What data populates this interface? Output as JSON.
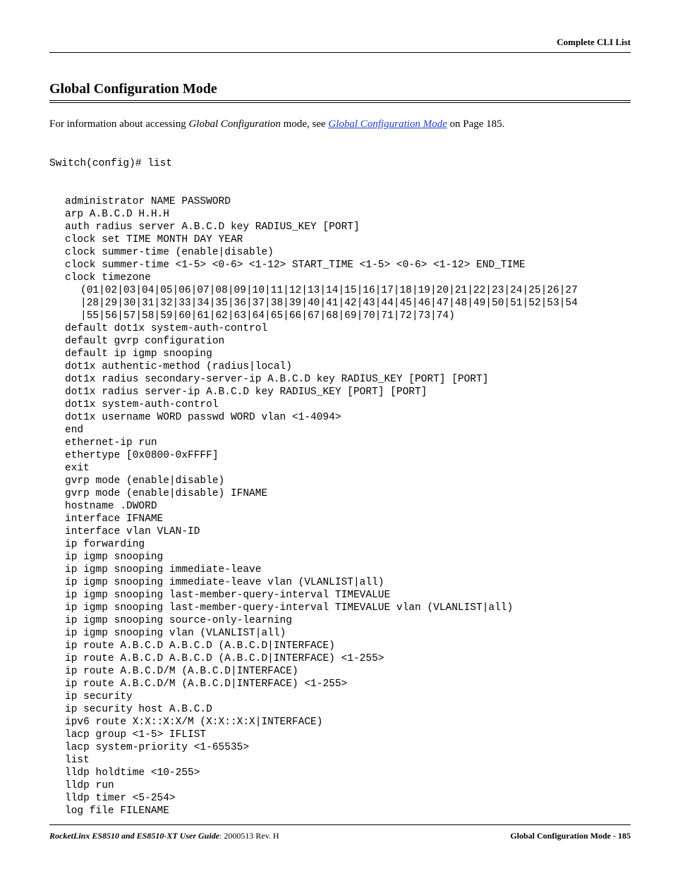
{
  "header": {
    "right_label": "Complete CLI List"
  },
  "section": {
    "title": "Global Configuration Mode"
  },
  "intro": {
    "prefix": "For information about accessing ",
    "emph": "Global Configuration",
    "mid": " mode, see ",
    "link_text": "Global Configuration Mode",
    "suffix": " on Page 185."
  },
  "cli": {
    "prompt": "Switch(config)# list",
    "lines": [
      "administrator NAME PASSWORD",
      "arp A.B.C.D H.H.H",
      "auth radius server A.B.C.D key RADIUS_KEY [PORT]",
      "clock set TIME MONTH DAY YEAR",
      "clock summer-time (enable|disable)",
      "clock summer-time <1-5> <0-6> <1-12> START_TIME <1-5> <0-6> <1-12> END_TIME",
      "clock timezone ",
      "(01|02|03|04|05|06|07|08|09|10|11|12|13|14|15|16|17|18|19|20|21|22|23|24|25|26|27",
      "|28|29|30|31|32|33|34|35|36|37|38|39|40|41|42|43|44|45|46|47|48|49|50|51|52|53|54",
      "|55|56|57|58|59|60|61|62|63|64|65|66|67|68|69|70|71|72|73|74)",
      "default dot1x system-auth-control",
      "default gvrp configuration",
      "default ip igmp snooping",
      "dot1x authentic-method (radius|local)",
      "dot1x radius secondary-server-ip A.B.C.D key RADIUS_KEY [PORT] [PORT]",
      "dot1x radius server-ip A.B.C.D key RADIUS_KEY [PORT] [PORT]",
      "dot1x system-auth-control",
      "dot1x username WORD passwd WORD vlan <1-4094>",
      "end",
      "ethernet-ip run",
      "ethertype [0x0800-0xFFFF]",
      "exit",
      "gvrp mode (enable|disable)",
      "gvrp mode (enable|disable) IFNAME",
      "hostname .DWORD",
      "interface IFNAME",
      "interface vlan VLAN-ID",
      "ip forwarding",
      "ip igmp snooping",
      "ip igmp snooping immediate-leave",
      "ip igmp snooping immediate-leave vlan (VLANLIST|all)",
      "ip igmp snooping last-member-query-interval TIMEVALUE",
      "ip igmp snooping last-member-query-interval TIMEVALUE vlan (VLANLIST|all)",
      "ip igmp snooping source-only-learning",
      "ip igmp snooping vlan (VLANLIST|all)",
      "ip route A.B.C.D A.B.C.D (A.B.C.D|INTERFACE)",
      "ip route A.B.C.D A.B.C.D (A.B.C.D|INTERFACE) <1-255>",
      "ip route A.B.C.D/M (A.B.C.D|INTERFACE)",
      "ip route A.B.C.D/M (A.B.C.D|INTERFACE) <1-255>",
      "ip security",
      "ip security host A.B.C.D",
      "ipv6 route X:X::X:X/M (X:X::X:X|INTERFACE)",
      "lacp group <1-5> IFLIST",
      "lacp system-priority <1-65535>",
      "list",
      "lldp holdtime <10-255>",
      "lldp run",
      "lldp timer <5-254>",
      "log file FILENAME"
    ],
    "indent2_indices": [
      7,
      8,
      9
    ]
  },
  "footer": {
    "left_bold": "RocketLinx ES8510  and ES8510-XT User Guide",
    "left_rest": ": 2000513 Rev. H",
    "right": "Global Configuration Mode - 185"
  }
}
